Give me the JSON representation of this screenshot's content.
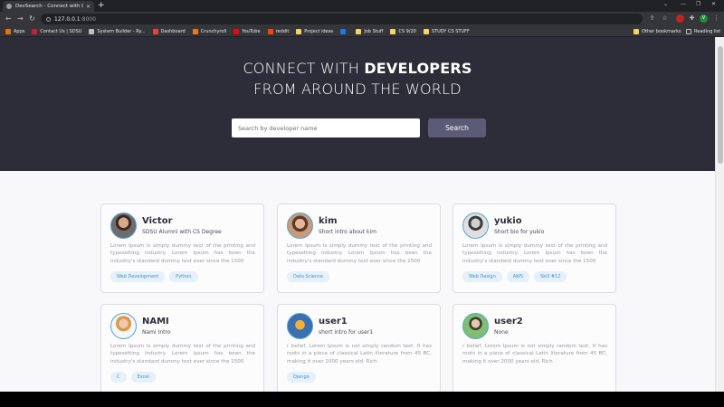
{
  "browser": {
    "tab_title": "DevSearch - Connect with Develo",
    "url_host": "127.0.0.1",
    "url_port": ":8000",
    "profile_initial": "V",
    "bookmarks": [
      {
        "label": "Apps",
        "icon": "apps-grid-icon",
        "color": "#e8710a"
      },
      {
        "label": "Contact Us | SDSU",
        "icon": "sdsu-icon",
        "color": "#c41e3a"
      },
      {
        "label": "System Builder - Ry...",
        "icon": "gear-icon",
        "color": "#bdc1c6"
      },
      {
        "label": "Dashboard",
        "icon": "dashboard-icon",
        "color": "#ea4335"
      },
      {
        "label": "Crunchyroll",
        "icon": "crunchyroll-icon",
        "color": "#f47521"
      },
      {
        "label": "YouTube",
        "icon": "youtube-icon",
        "color": "#ff0000"
      },
      {
        "label": "reddit",
        "icon": "reddit-icon",
        "color": "#ff4500"
      },
      {
        "label": "Project ideas",
        "icon": "folder-icon",
        "color": "#f6d365"
      },
      {
        "label": "",
        "icon": "facebook-icon",
        "color": "#1877f2"
      },
      {
        "label": "Job Stuff",
        "icon": "folder-icon",
        "color": "#f6d365"
      },
      {
        "label": "CS 9/20",
        "icon": "folder-icon",
        "color": "#f6d365"
      },
      {
        "label": "STUDY CS STUFF",
        "icon": "folder-icon",
        "color": "#f6d365"
      }
    ],
    "other_bookmarks": "Other bookmarks",
    "reading_list": "Reading list"
  },
  "hero": {
    "title_line1_prefix": "CONNECT WITH ",
    "title_line1_bold": "DEVELOPERS",
    "title_line2": "FROM AROUND THE WORLD",
    "search_placeholder": "Search by developer name",
    "search_button": "Search"
  },
  "colors": {
    "hero_bg": "#2d2d39",
    "accent": "#5b5b78",
    "tag_text": "#4a8fc7",
    "tag_bg": "#e4f0fa"
  },
  "developers": [
    {
      "name": "Victor",
      "intro": "SDSU Alumni with CS Degree",
      "bio": "Lorem Ipsum is simply dummy text of the printing and typesetting industry. Lorem Ipsum has been the industry's standard dummy text ever since the 1500",
      "skills": [
        "Web Development",
        "Python"
      ],
      "avatar": "person-photo-icon"
    },
    {
      "name": "kim",
      "intro": "Short intro about kim",
      "bio": "Lorem Ipsum is simply dummy text of the printing and typesetting industry. Lorem Ipsum has been the industry's standard dummy text ever since the 1500",
      "skills": [
        "Data Science"
      ],
      "avatar": "person-photo-icon"
    },
    {
      "name": "yukio",
      "intro": "Short bio for yukio",
      "bio": "Lorem Ipsum is simply dummy text of the printing and typesetting industry. Lorem Ipsum has been the industry's standard dummy text ever since the 1500",
      "skills": [
        "Web Design",
        "AWS",
        "Skill #12"
      ],
      "avatar": "person-photo-icon"
    },
    {
      "name": "NAMI",
      "intro": "Nami Intro",
      "bio": "Lorem Ipsum is simply dummy text of the printing and typesetting industry. Lorem Ipsum has been the industry's standard dummy text ever since the 1500",
      "skills": [
        "C",
        "Excel"
      ],
      "avatar": "person-photo-icon"
    },
    {
      "name": "user1",
      "intro": "short intro for user1",
      "bio": "r belief, Lorem Ipsum is not simply random text. It has roots in a piece of classical Latin literature from 45 BC, making it over 2000 years old. Rich",
      "skills": [
        "Django"
      ],
      "avatar": "default-avatar-icon"
    },
    {
      "name": "user2",
      "intro": "None",
      "bio": "r belief, Lorem Ipsum is not simply random text. It has roots in a piece of classical Latin literature from 45 BC, making it over 2000 years old. Rich",
      "skills": [],
      "avatar": "default-avatar-icon"
    }
  ]
}
